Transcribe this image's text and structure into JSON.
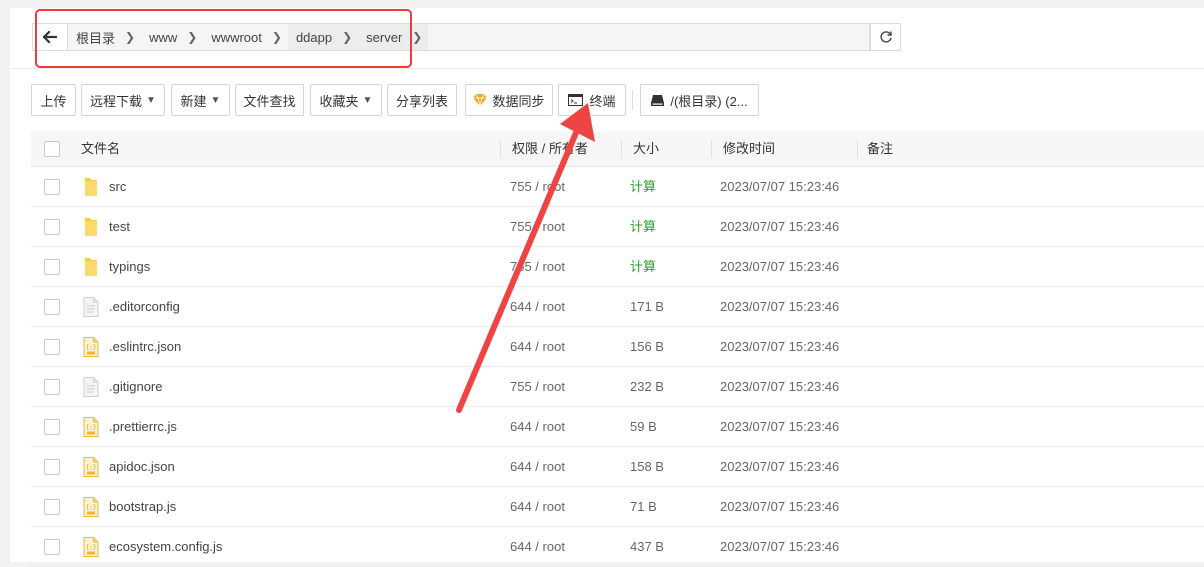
{
  "breadcrumb": {
    "items": [
      {
        "label": "根目录"
      },
      {
        "label": "www"
      },
      {
        "label": "wwwroot"
      },
      {
        "label": "ddapp"
      },
      {
        "label": "server"
      }
    ]
  },
  "toolbar": {
    "upload": "上传",
    "remote_download": "远程下载",
    "new": "新建",
    "file_search": "文件查找",
    "favorites": "收藏夹",
    "share_list": "分享列表",
    "data_sync": "数据同步",
    "terminal": "终端",
    "disk": "/(根目录) (2..."
  },
  "table": {
    "headers": {
      "name": "文件名",
      "perm_owner": "权限 / 所有者",
      "size": "大小",
      "mtime": "修改时间",
      "note": "备注"
    },
    "rows": [
      {
        "name": "src",
        "type": "folder",
        "perm": "755 / root",
        "size": "计算",
        "mtime": "2023/07/07 15:23:46"
      },
      {
        "name": "test",
        "type": "folder",
        "perm": "755 / root",
        "size": "计算",
        "mtime": "2023/07/07 15:23:46"
      },
      {
        "name": "typings",
        "type": "folder",
        "perm": "755 / root",
        "size": "计算",
        "mtime": "2023/07/07 15:23:46"
      },
      {
        "name": ".editorconfig",
        "type": "text",
        "perm": "644 / root",
        "size": "171 B",
        "mtime": "2023/07/07 15:23:46"
      },
      {
        "name": ".eslintrc.json",
        "type": "code",
        "perm": "644 / root",
        "size": "156 B",
        "mtime": "2023/07/07 15:23:46"
      },
      {
        "name": ".gitignore",
        "type": "text",
        "perm": "755 / root",
        "size": "232 B",
        "mtime": "2023/07/07 15:23:46"
      },
      {
        "name": ".prettierrc.js",
        "type": "code",
        "perm": "644 / root",
        "size": "59 B",
        "mtime": "2023/07/07 15:23:46"
      },
      {
        "name": "apidoc.json",
        "type": "code",
        "perm": "644 / root",
        "size": "158 B",
        "mtime": "2023/07/07 15:23:46"
      },
      {
        "name": "bootstrap.js",
        "type": "code",
        "perm": "644 / root",
        "size": "71 B",
        "mtime": "2023/07/07 15:23:46"
      },
      {
        "name": "ecosystem.config.js",
        "type": "code",
        "perm": "644 / root",
        "size": "437 B",
        "mtime": "2023/07/07 15:23:46"
      }
    ]
  },
  "colors": {
    "highlight_box": "#ef3b3b",
    "arrow": "#ef4444",
    "calc_link": "#2c9f2c",
    "folder": "#f7c948"
  }
}
